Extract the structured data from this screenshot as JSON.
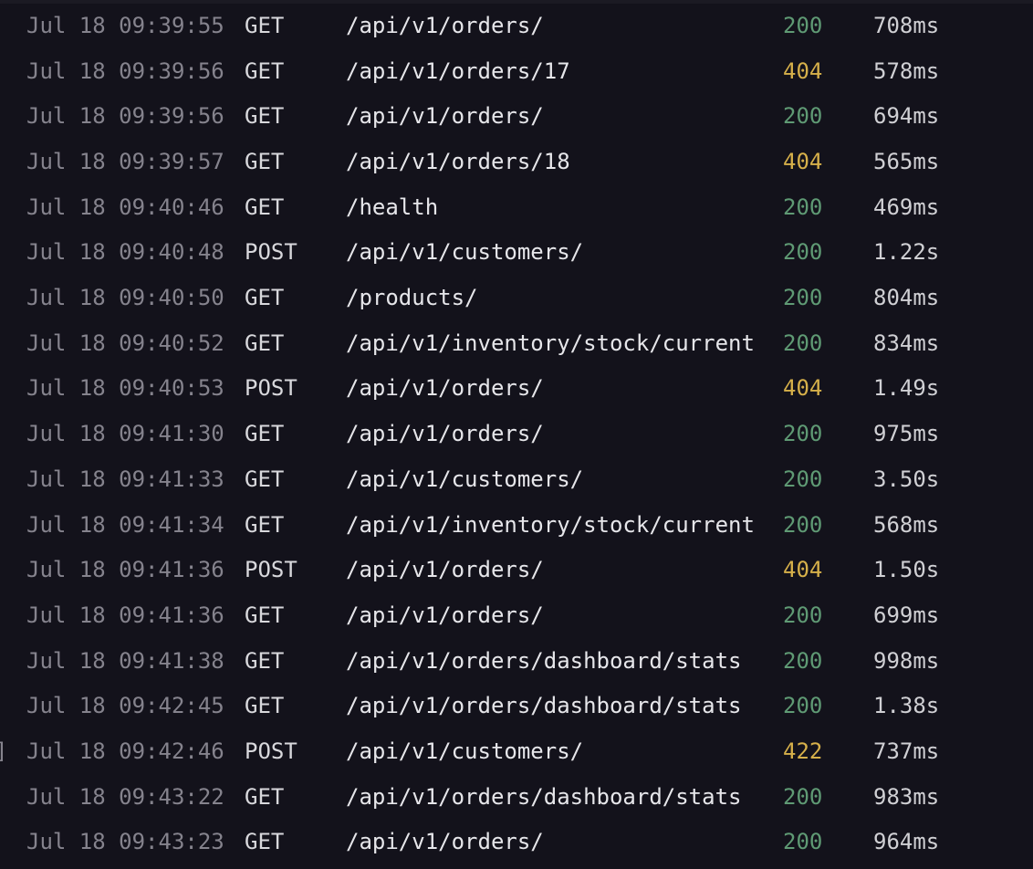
{
  "colors": {
    "background": "#13121b",
    "status_ok": "#5f9a74",
    "status_warn": "#d6b04a"
  },
  "rows": [
    {
      "timestamp": "Jul 18 09:39:55",
      "method": "GET",
      "path": "/api/v1/orders/",
      "status": "200",
      "duration": "708ms"
    },
    {
      "timestamp": "Jul 18 09:39:56",
      "method": "GET",
      "path": "/api/v1/orders/17",
      "status": "404",
      "duration": "578ms"
    },
    {
      "timestamp": "Jul 18 09:39:56",
      "method": "GET",
      "path": "/api/v1/orders/",
      "status": "200",
      "duration": "694ms"
    },
    {
      "timestamp": "Jul 18 09:39:57",
      "method": "GET",
      "path": "/api/v1/orders/18",
      "status": "404",
      "duration": "565ms"
    },
    {
      "timestamp": "Jul 18 09:40:46",
      "method": "GET",
      "path": "/health",
      "status": "200",
      "duration": "469ms"
    },
    {
      "timestamp": "Jul 18 09:40:48",
      "method": "POST",
      "path": "/api/v1/customers/",
      "status": "200",
      "duration": "1.22s"
    },
    {
      "timestamp": "Jul 18 09:40:50",
      "method": "GET",
      "path": "/products/",
      "status": "200",
      "duration": "804ms"
    },
    {
      "timestamp": "Jul 18 09:40:52",
      "method": "GET",
      "path": "/api/v1/inventory/stock/current",
      "status": "200",
      "duration": "834ms"
    },
    {
      "timestamp": "Jul 18 09:40:53",
      "method": "POST",
      "path": "/api/v1/orders/",
      "status": "404",
      "duration": "1.49s"
    },
    {
      "timestamp": "Jul 18 09:41:30",
      "method": "GET",
      "path": "/api/v1/orders/",
      "status": "200",
      "duration": "975ms"
    },
    {
      "timestamp": "Jul 18 09:41:33",
      "method": "GET",
      "path": "/api/v1/customers/",
      "status": "200",
      "duration": "3.50s"
    },
    {
      "timestamp": "Jul 18 09:41:34",
      "method": "GET",
      "path": "/api/v1/inventory/stock/current",
      "status": "200",
      "duration": "568ms"
    },
    {
      "timestamp": "Jul 18 09:41:36",
      "method": "POST",
      "path": "/api/v1/orders/",
      "status": "404",
      "duration": "1.50s"
    },
    {
      "timestamp": "Jul 18 09:41:36",
      "method": "GET",
      "path": "/api/v1/orders/",
      "status": "200",
      "duration": "699ms"
    },
    {
      "timestamp": "Jul 18 09:41:38",
      "method": "GET",
      "path": "/api/v1/orders/dashboard/stats",
      "status": "200",
      "duration": "998ms"
    },
    {
      "timestamp": "Jul 18 09:42:45",
      "method": "GET",
      "path": "/api/v1/orders/dashboard/stats",
      "status": "200",
      "duration": "1.38s"
    },
    {
      "timestamp": "Jul 18 09:42:46",
      "method": "POST",
      "path": "/api/v1/customers/",
      "status": "422",
      "duration": "737ms",
      "marker": "]"
    },
    {
      "timestamp": "Jul 18 09:43:22",
      "method": "GET",
      "path": "/api/v1/orders/dashboard/stats",
      "status": "200",
      "duration": "983ms"
    },
    {
      "timestamp": "Jul 18 09:43:23",
      "method": "GET",
      "path": "/api/v1/orders/",
      "status": "200",
      "duration": "964ms"
    }
  ]
}
